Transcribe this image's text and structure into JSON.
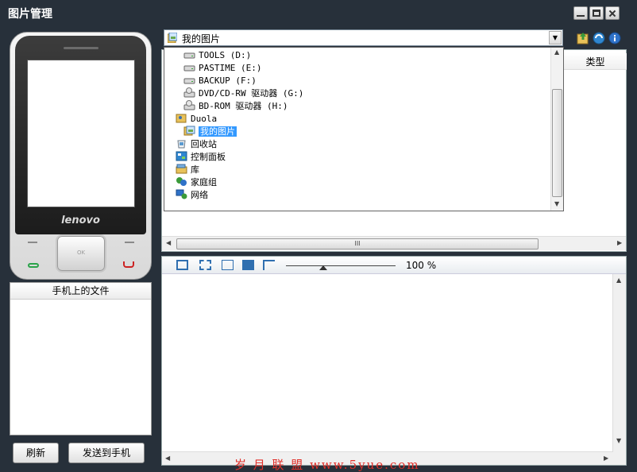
{
  "window": {
    "title": "图片管理"
  },
  "phone": {
    "brand": "lenovo",
    "ok_label": "OK"
  },
  "files_panel": {
    "header": "手机上的文件"
  },
  "buttons": {
    "refresh": "刷新",
    "send_to_phone": "发送到手机"
  },
  "address": {
    "current": "我的图片"
  },
  "list": {
    "type_header": "类型"
  },
  "dropdown": {
    "items": [
      {
        "label": "TOOLS (D:)",
        "icon": "drive-icon"
      },
      {
        "label": "PASTIME (E:)",
        "icon": "drive-icon"
      },
      {
        "label": "BACKUP (F:)",
        "icon": "drive-icon"
      },
      {
        "label": "DVD/CD-RW 驱动器 (G:)",
        "icon": "optical-drive-icon"
      },
      {
        "label": "BD-ROM 驱动器 (H:)",
        "icon": "optical-drive-icon"
      },
      {
        "label": "Duola",
        "icon": "user-folder-icon"
      },
      {
        "label": "我的图片",
        "icon": "pictures-folder-icon"
      },
      {
        "label": "回收站",
        "icon": "recycle-bin-icon"
      },
      {
        "label": "控制面板",
        "icon": "control-panel-icon"
      },
      {
        "label": "库",
        "icon": "library-icon"
      },
      {
        "label": "家庭组",
        "icon": "homegroup-icon"
      },
      {
        "label": "网络",
        "icon": "network-icon"
      }
    ]
  },
  "viewer": {
    "zoom": "100 %",
    "hscroll_grip": "III"
  },
  "watermark": "岁 月 联 盟  www.5yue.com",
  "colors": {
    "titlebar": "#27303a",
    "selection": "#3399ff",
    "tool_icon": "#2f6fb0"
  }
}
